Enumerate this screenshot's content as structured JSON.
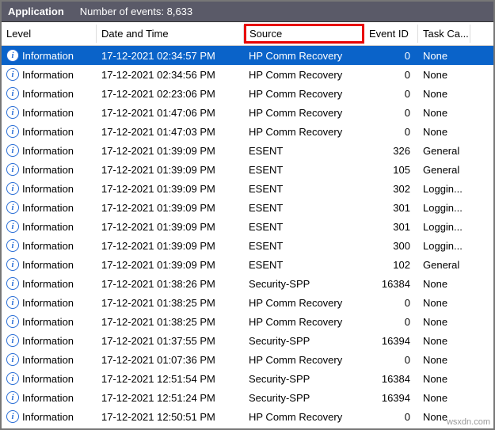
{
  "header": {
    "title": "Application",
    "count_label": "Number of events: 8,633"
  },
  "columns": {
    "level": "Level",
    "date": "Date and Time",
    "source": "Source",
    "event_id": "Event ID",
    "task": "Task Ca..."
  },
  "icon_glyph": "i",
  "rows": [
    {
      "level": "Information",
      "date": "17-12-2021 02:34:57 PM",
      "source": "HP Comm Recovery",
      "event_id": "0",
      "task": "None",
      "selected": true
    },
    {
      "level": "Information",
      "date": "17-12-2021 02:34:56 PM",
      "source": "HP Comm Recovery",
      "event_id": "0",
      "task": "None"
    },
    {
      "level": "Information",
      "date": "17-12-2021 02:23:06 PM",
      "source": "HP Comm Recovery",
      "event_id": "0",
      "task": "None"
    },
    {
      "level": "Information",
      "date": "17-12-2021 01:47:06 PM",
      "source": "HP Comm Recovery",
      "event_id": "0",
      "task": "None"
    },
    {
      "level": "Information",
      "date": "17-12-2021 01:47:03 PM",
      "source": "HP Comm Recovery",
      "event_id": "0",
      "task": "None"
    },
    {
      "level": "Information",
      "date": "17-12-2021 01:39:09 PM",
      "source": "ESENT",
      "event_id": "326",
      "task": "General"
    },
    {
      "level": "Information",
      "date": "17-12-2021 01:39:09 PM",
      "source": "ESENT",
      "event_id": "105",
      "task": "General"
    },
    {
      "level": "Information",
      "date": "17-12-2021 01:39:09 PM",
      "source": "ESENT",
      "event_id": "302",
      "task": "Loggin..."
    },
    {
      "level": "Information",
      "date": "17-12-2021 01:39:09 PM",
      "source": "ESENT",
      "event_id": "301",
      "task": "Loggin..."
    },
    {
      "level": "Information",
      "date": "17-12-2021 01:39:09 PM",
      "source": "ESENT",
      "event_id": "301",
      "task": "Loggin..."
    },
    {
      "level": "Information",
      "date": "17-12-2021 01:39:09 PM",
      "source": "ESENT",
      "event_id": "300",
      "task": "Loggin..."
    },
    {
      "level": "Information",
      "date": "17-12-2021 01:39:09 PM",
      "source": "ESENT",
      "event_id": "102",
      "task": "General"
    },
    {
      "level": "Information",
      "date": "17-12-2021 01:38:26 PM",
      "source": "Security-SPP",
      "event_id": "16384",
      "task": "None"
    },
    {
      "level": "Information",
      "date": "17-12-2021 01:38:25 PM",
      "source": "HP Comm Recovery",
      "event_id": "0",
      "task": "None"
    },
    {
      "level": "Information",
      "date": "17-12-2021 01:38:25 PM",
      "source": "HP Comm Recovery",
      "event_id": "0",
      "task": "None"
    },
    {
      "level": "Information",
      "date": "17-12-2021 01:37:55 PM",
      "source": "Security-SPP",
      "event_id": "16394",
      "task": "None"
    },
    {
      "level": "Information",
      "date": "17-12-2021 01:07:36 PM",
      "source": "HP Comm Recovery",
      "event_id": "0",
      "task": "None"
    },
    {
      "level": "Information",
      "date": "17-12-2021 12:51:54 PM",
      "source": "Security-SPP",
      "event_id": "16384",
      "task": "None"
    },
    {
      "level": "Information",
      "date": "17-12-2021 12:51:24 PM",
      "source": "Security-SPP",
      "event_id": "16394",
      "task": "None"
    },
    {
      "level": "Information",
      "date": "17-12-2021 12:50:51 PM",
      "source": "HP Comm Recovery",
      "event_id": "0",
      "task": "None"
    }
  ],
  "watermark": "wsxdn.com"
}
